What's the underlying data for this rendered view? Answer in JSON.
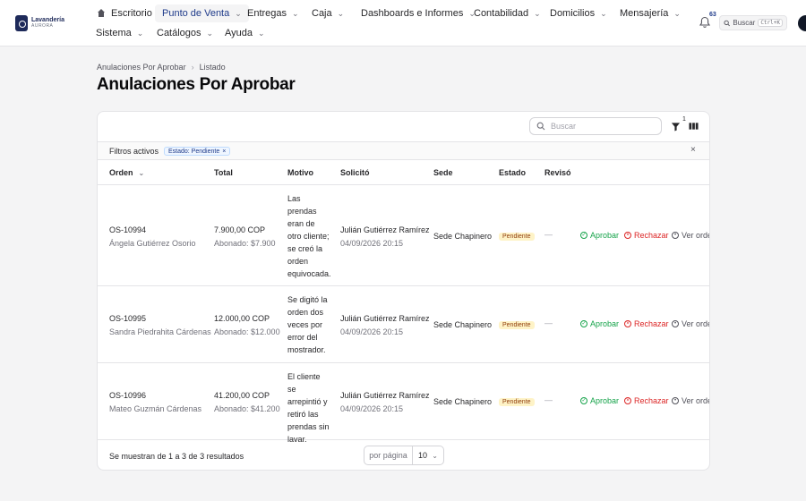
{
  "brand": {
    "line1": "Lavandería",
    "line2": "AURORA"
  },
  "nav": {
    "home": "Escritorio",
    "punto_venta": "Punto de Venta",
    "entregas": "Entregas",
    "caja": "Caja",
    "dashboards": "Dashboards e Informes",
    "contabilidad": "Contabilidad",
    "domicilios": "Domicilios",
    "mensajeria": "Mensajería",
    "sistema": "Sistema",
    "catalogos": "Catálogos",
    "ayuda": "Ayuda"
  },
  "notifications": {
    "count": "63"
  },
  "global_search": {
    "label": "Buscar",
    "shortcut": "Ctrl+K"
  },
  "breadcrumb": {
    "first": "Anulaciones Por Aprobar",
    "second": "Listado"
  },
  "page_title": "Anulaciones Por Aprobar",
  "table_search": {
    "placeholder": "Buscar"
  },
  "filter_count": "1",
  "filters": {
    "label": "Filtros activos",
    "chip": "Estado: Pendiente",
    "chip_remove": "×",
    "clear": "×"
  },
  "columns": {
    "orden": "Orden",
    "total": "Total",
    "motivo": "Motivo",
    "solicito": "Solicitó",
    "sede": "Sede",
    "estado": "Estado",
    "reviso": "Revisó"
  },
  "rows": [
    {
      "order": "OS-10994",
      "client": "Ángela Gutiérrez Osorio",
      "total": "7.900,00 COP",
      "paid": "Abonado: $7.900",
      "reason": "Las prendas eran de otro cliente; se creó la orden equivocada.",
      "requester": "Julián Gutiérrez Ramírez",
      "date": "04/09/2026 20:15",
      "branch": "Sede Chapinero",
      "status": "Pendiente",
      "reviewer": "—"
    },
    {
      "order": "OS-10995",
      "client": "Sandra Piedrahita Cárdenas",
      "total": "12.000,00 COP",
      "paid": "Abonado: $12.000",
      "reason": "Se digitó la orden dos veces por error del mostrador.",
      "requester": "Julián Gutiérrez Ramírez",
      "date": "04/09/2026 20:15",
      "branch": "Sede Chapinero",
      "status": "Pendiente",
      "reviewer": "—"
    },
    {
      "order": "OS-10996",
      "client": "Mateo Guzmán Cárdenas",
      "total": "41.200,00 COP",
      "paid": "Abonado: $41.200",
      "reason": "El cliente se arrepintió y retiró las prendas sin lavar.",
      "requester": "Julián Gutiérrez Ramírez",
      "date": "04/09/2026 20:15",
      "branch": "Sede Chapinero",
      "status": "Pendiente",
      "reviewer": "—"
    }
  ],
  "actions": {
    "approve": "Aprobar",
    "reject": "Rechazar",
    "view": "Ver orden"
  },
  "footer": {
    "summary": "Se muestran de 1 a 3 de 3 resultados",
    "per_page_label": "por página",
    "per_page_value": "10"
  },
  "colors": {
    "accent": "#1e3a8a",
    "approve": "#16a34a",
    "reject": "#dc2626",
    "badge_bg": "#fef3c7",
    "badge_fg": "#92400e"
  }
}
